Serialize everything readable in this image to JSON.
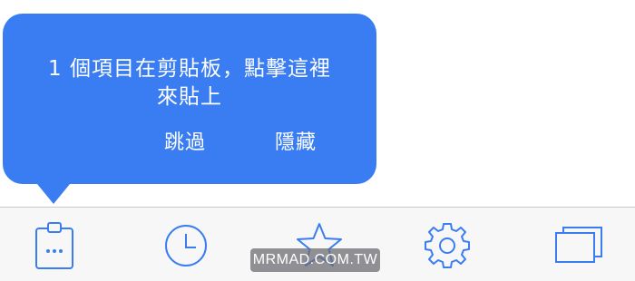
{
  "tooltip": {
    "message_line1": "1 個項目在剪貼板，點擊這裡",
    "message_line2": "來貼上",
    "skip_label": "跳過",
    "hide_label": "隱藏",
    "bg_color": "#3a7df2"
  },
  "tabbar": {
    "accent_color": "#3a7df2",
    "tabs": [
      {
        "icon": "clipboard-icon"
      },
      {
        "icon": "clock-icon"
      },
      {
        "icon": "star-icon"
      },
      {
        "icon": "gear-icon"
      },
      {
        "icon": "windows-icon"
      }
    ]
  },
  "watermark": {
    "text": "MRMAD.COM.TW"
  }
}
